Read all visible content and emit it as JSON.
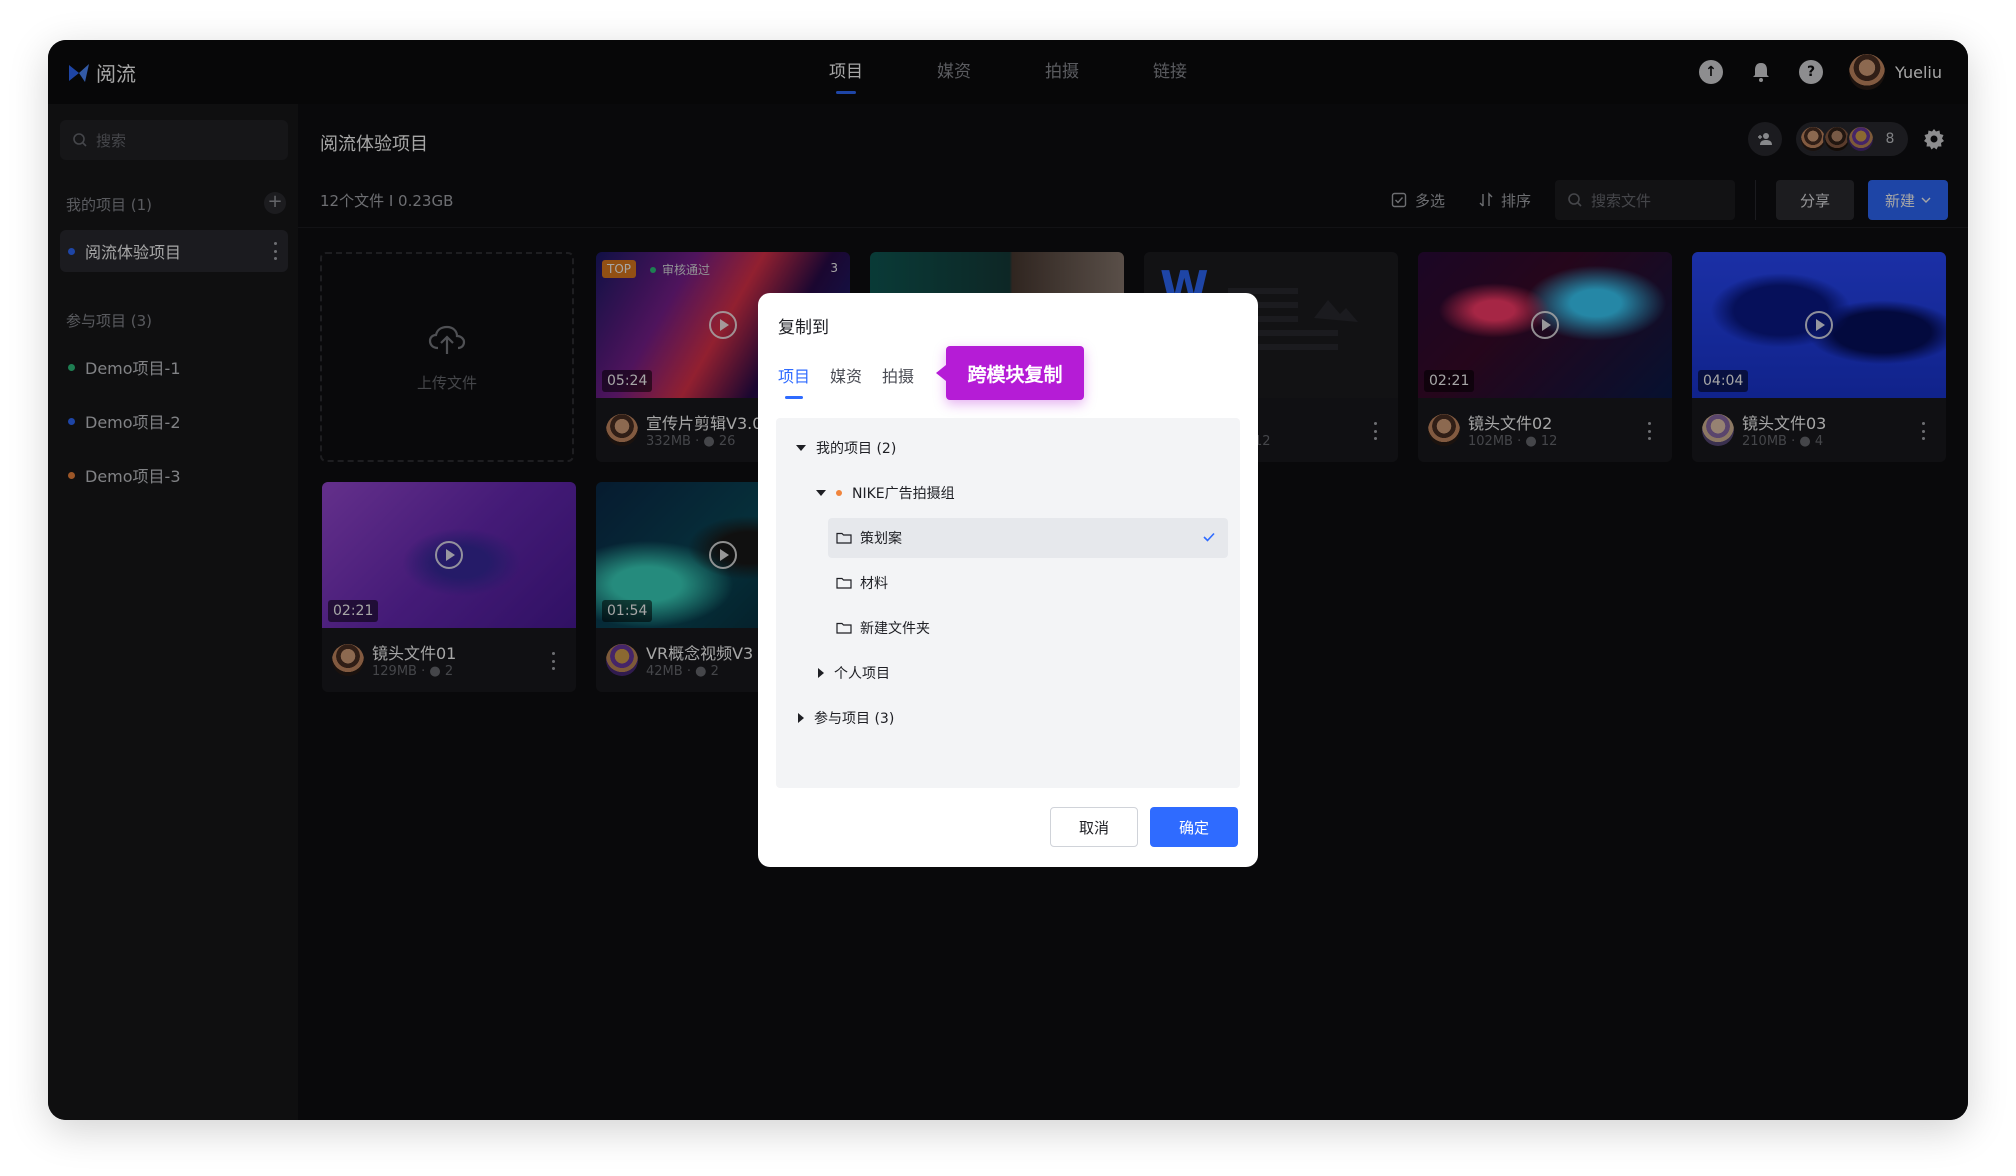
{
  "app": {
    "name": "阅流",
    "brand_color": "#2f6bff"
  },
  "nav": {
    "tabs": [
      "项目",
      "媒资",
      "拍摄",
      "链接"
    ],
    "active_index": 0
  },
  "user": {
    "name": "Yueliu"
  },
  "sidebar": {
    "search_placeholder": "搜索",
    "my_projects_label": "我的项目 (1)",
    "my_projects": [
      {
        "label": "阅流体验项目",
        "color": "#2f6bff"
      }
    ],
    "joined_label": "参与项目 (3)",
    "joined": [
      {
        "label": "Demo项目-1",
        "color": "#2ec27e"
      },
      {
        "label": "Demo项目-2",
        "color": "#2f6bff"
      },
      {
        "label": "Demo项目-3",
        "color": "#f0843c"
      }
    ]
  },
  "project": {
    "title": "阅流体验项目",
    "member_count": "8",
    "file_stats": "12个文件  I  0.23GB"
  },
  "toolbar": {
    "multi_select": "多选",
    "sort": "排序",
    "search_placeholder": "搜索文件",
    "share": "分享",
    "new": "新建"
  },
  "upload_label": "上传文件",
  "files": [
    {
      "name": "宣传片剪辑V3.0",
      "duration": "05:24",
      "size": "332MB",
      "comments": "26",
      "badge": "TOP",
      "status": "审核通过",
      "version": "3"
    },
    {
      "name": "",
      "duration": "",
      "size": "",
      "comments": ""
    },
    {
      "name": "",
      "duration": "",
      "size": "",
      "comments": "12"
    },
    {
      "name": "镜头文件02",
      "duration": "02:21",
      "size": "102MB",
      "comments": "12"
    },
    {
      "name": "镜头文件03",
      "duration": "04:04",
      "size": "210MB",
      "comments": "4"
    },
    {
      "name": "镜头文件01",
      "duration": "02:21",
      "size": "129MB",
      "comments": "2"
    },
    {
      "name": "VR概念视频V3",
      "duration": "01:54",
      "size": "42MB",
      "comments": "2"
    }
  ],
  "modal": {
    "title": "复制到",
    "tabs": [
      "项目",
      "媒资",
      "拍摄"
    ],
    "active_tab": 0,
    "callout": "跨模块复制",
    "tree": {
      "my_projects": "我的项目 (2)",
      "nike_group": "NIKE广告拍摄组",
      "folders": [
        "策划案",
        "材料",
        "新建文件夹"
      ],
      "selected_folder": "策划案",
      "personal": "个人项目",
      "joined": "参与项目 (3)"
    },
    "cancel": "取消",
    "confirm": "确定"
  }
}
